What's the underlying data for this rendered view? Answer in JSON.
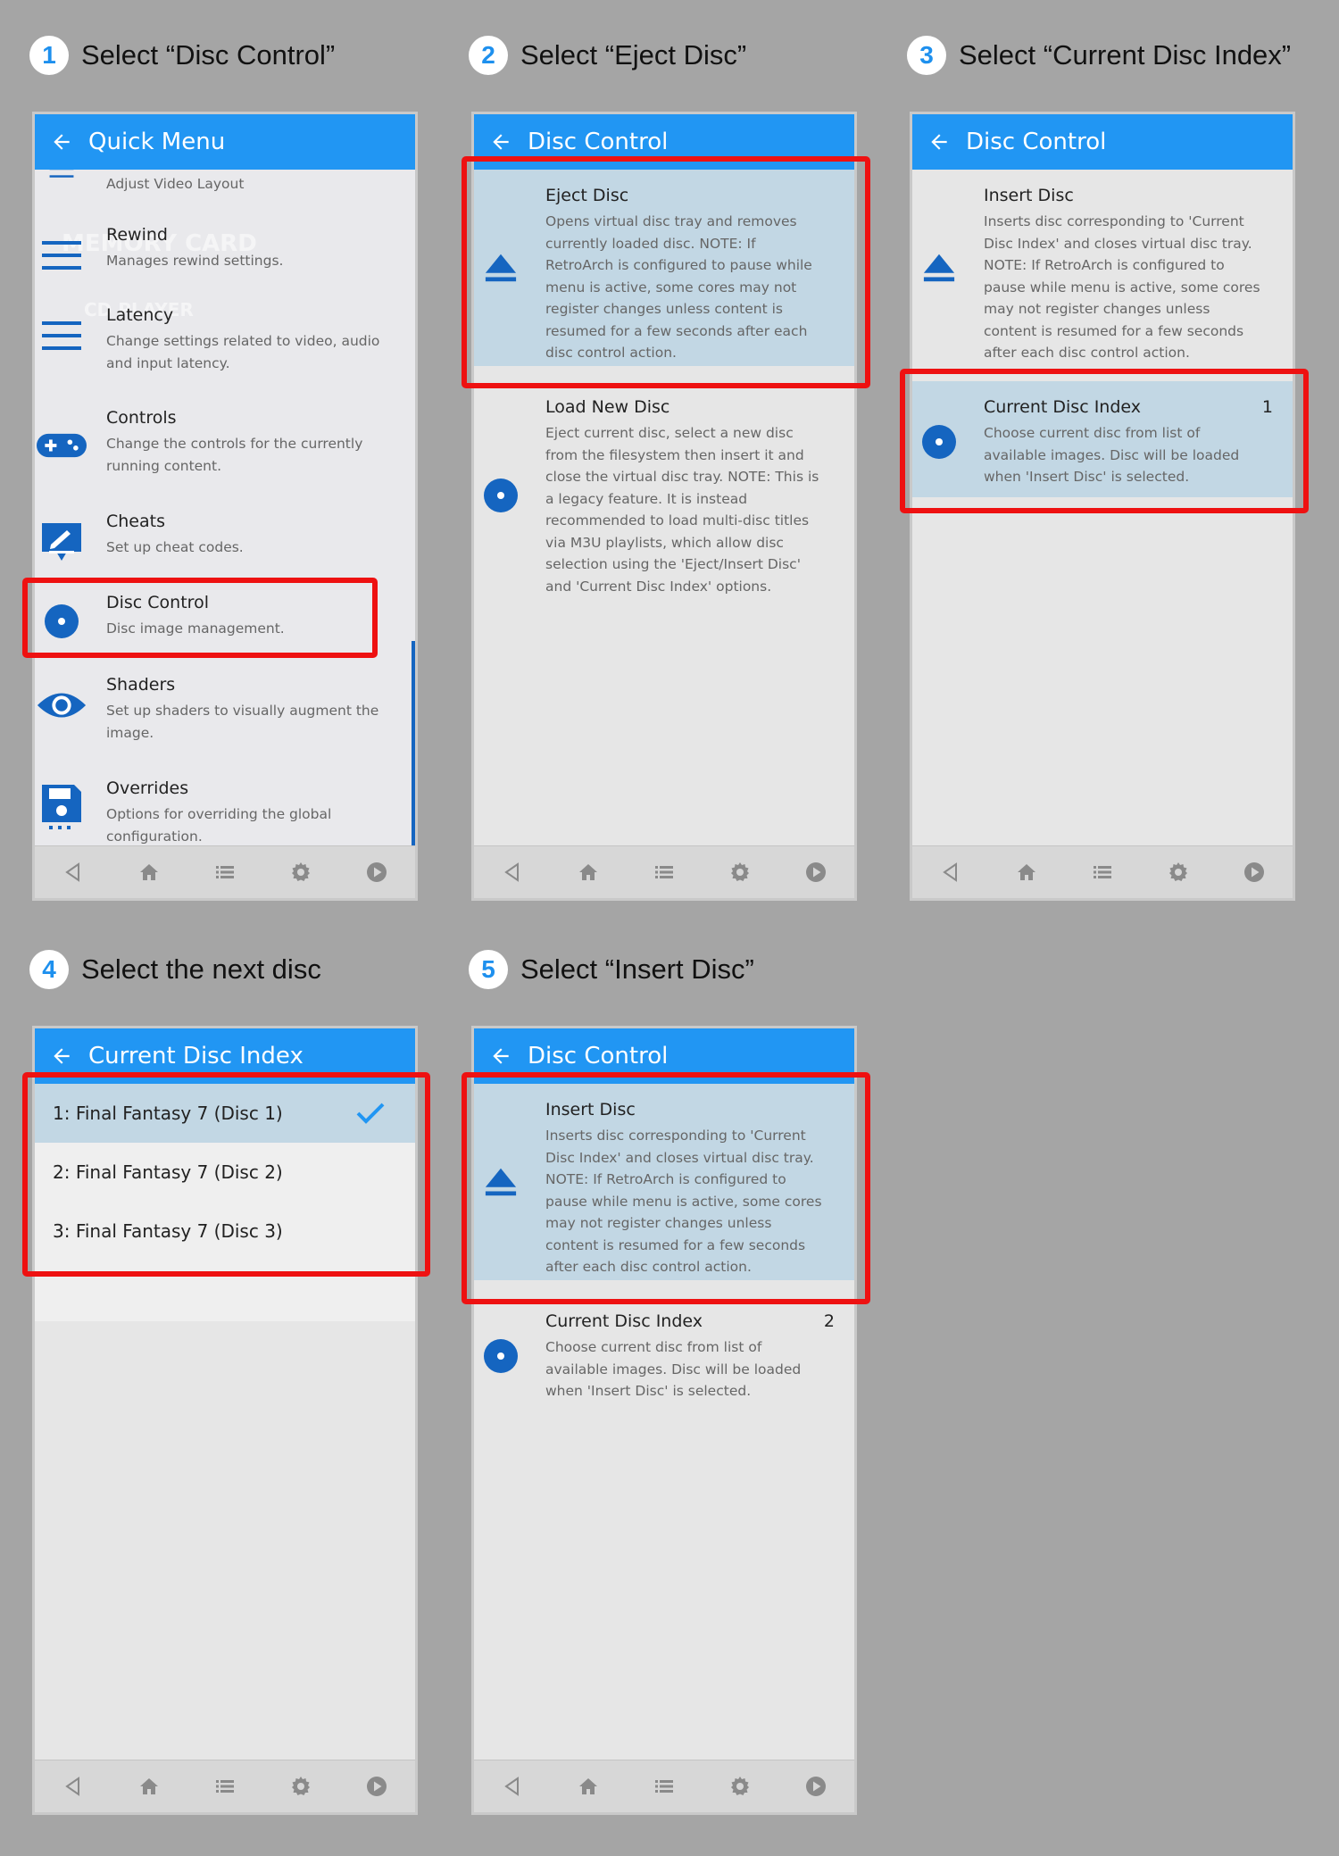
{
  "steps": [
    {
      "num": "1",
      "label": "Select “Disc Control”"
    },
    {
      "num": "2",
      "label": "Select “Eject Disc”"
    },
    {
      "num": "3",
      "label": "Select “Current Disc Index”"
    },
    {
      "num": "4",
      "label": "Select the next disc"
    },
    {
      "num": "5",
      "label": "Select “Insert Disc”"
    }
  ],
  "screens": {
    "s1": {
      "header": "Quick Menu",
      "items": [
        {
          "title": "",
          "desc": "Adjust Video Layout"
        },
        {
          "title": "Rewind",
          "desc": "Manages rewind settings."
        },
        {
          "title": "Latency",
          "desc": "Change settings related to video, audio and input latency."
        },
        {
          "title": "Controls",
          "desc": "Change the controls for the currently running content."
        },
        {
          "title": "Cheats",
          "desc": "Set up cheat codes."
        },
        {
          "title": "Disc Control",
          "desc": "Disc image management."
        },
        {
          "title": "Shaders",
          "desc": "Set up shaders to visually augment the image."
        },
        {
          "title": "Overrides",
          "desc": "Options for overriding the global configuration."
        }
      ],
      "watermark1": "MEMORY CARD",
      "watermark2": "CD PLAYER"
    },
    "s2": {
      "header": "Disc Control",
      "items": [
        {
          "title": "Eject Disc",
          "desc": "Opens virtual disc tray and removes currently loaded disc. NOTE: If RetroArch is configured to pause while menu is active, some cores may not register changes unless content is resumed for a few seconds after each disc control action."
        },
        {
          "title": "Load New Disc",
          "desc": "Eject current disc, select a new disc from the filesystem then insert it and close the virtual disc tray. NOTE: This is a legacy feature. It is instead recommended to load multi-disc titles via M3U playlists, which allow disc selection using the 'Eject/Insert Disc' and 'Current Disc Index' options."
        }
      ]
    },
    "s3": {
      "header": "Disc Control",
      "items": [
        {
          "title": "Insert Disc",
          "desc": "Inserts disc corresponding to 'Current Disc Index' and closes virtual disc tray. NOTE: If RetroArch is configured to pause while menu is active, some cores may not register changes unless content is resumed for a few seconds after each disc control action."
        },
        {
          "title": "Current Disc Index",
          "value": "1",
          "desc": "Choose current disc from list of available images. Disc will be loaded when 'Insert Disc' is selected."
        }
      ]
    },
    "s4": {
      "header": "Current Disc Index",
      "options": [
        {
          "label": "1:  Final Fantasy 7 (Disc 1)"
        },
        {
          "label": "2:  Final Fantasy 7 (Disc 2)"
        },
        {
          "label": "3:  Final Fantasy 7 (Disc 3)"
        }
      ]
    },
    "s5": {
      "header": "Disc Control",
      "items": [
        {
          "title": "Insert Disc",
          "desc": "Inserts disc corresponding to 'Current Disc Index' and closes virtual disc tray. NOTE: If RetroArch is configured to pause while menu is active, some cores may not register changes unless content is resumed for a few seconds after each disc control action."
        },
        {
          "title": "Current Disc Index",
          "value": "2",
          "desc": "Choose current disc from list of available images. Disc will be loaded when 'Insert Disc' is selected."
        }
      ]
    }
  },
  "colors": {
    "accent": "#2196f3",
    "icon": "#1565c0",
    "selected": "#c2d7e4",
    "highlight": "#e11111"
  }
}
